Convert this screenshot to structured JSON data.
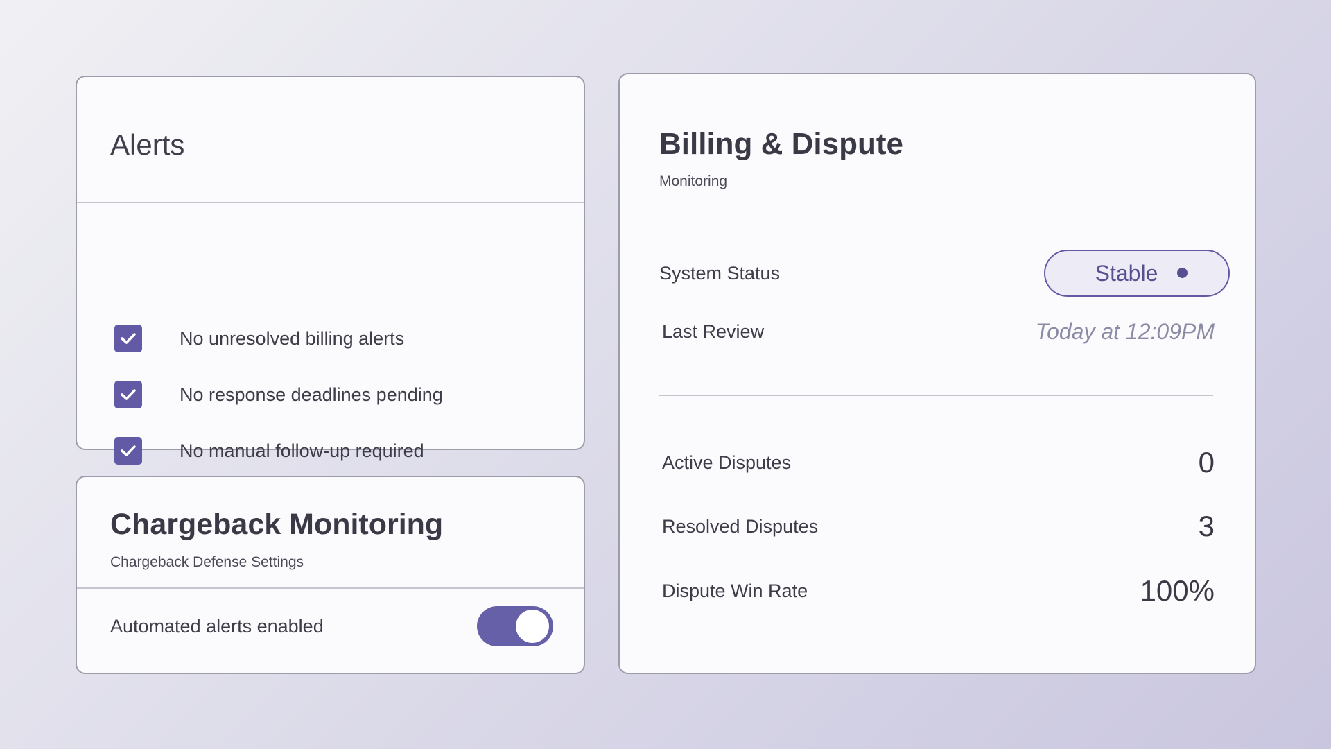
{
  "alerts": {
    "title": "Alerts",
    "items": [
      {
        "label": "No unresolved billing alerts",
        "checked": true
      },
      {
        "label": "No response deadlines pending",
        "checked": true
      },
      {
        "label": "No manual follow-up required",
        "checked": true
      }
    ]
  },
  "chargeback": {
    "title": "Chargeback Monitoring",
    "subtitle": "Chargeback Defense Settings",
    "toggle_label": "Automated alerts enabled",
    "toggle_on": true
  },
  "billing": {
    "title": "Billing & Dispute",
    "subtitle": "Monitoring",
    "system_status_label": "System Status",
    "system_status_value": "Stable",
    "last_review_label": "Last Review",
    "last_review_value": "Today at 12:09PM",
    "metrics": [
      {
        "label": "Active Disputes",
        "value": "0"
      },
      {
        "label": "Resolved Disputes",
        "value": "3"
      },
      {
        "label": "Dispute Win Rate",
        "value": "100%"
      }
    ]
  },
  "colors": {
    "accent": "#625aa5",
    "text": "#3d3c48",
    "muted": "#8c8ba6"
  }
}
